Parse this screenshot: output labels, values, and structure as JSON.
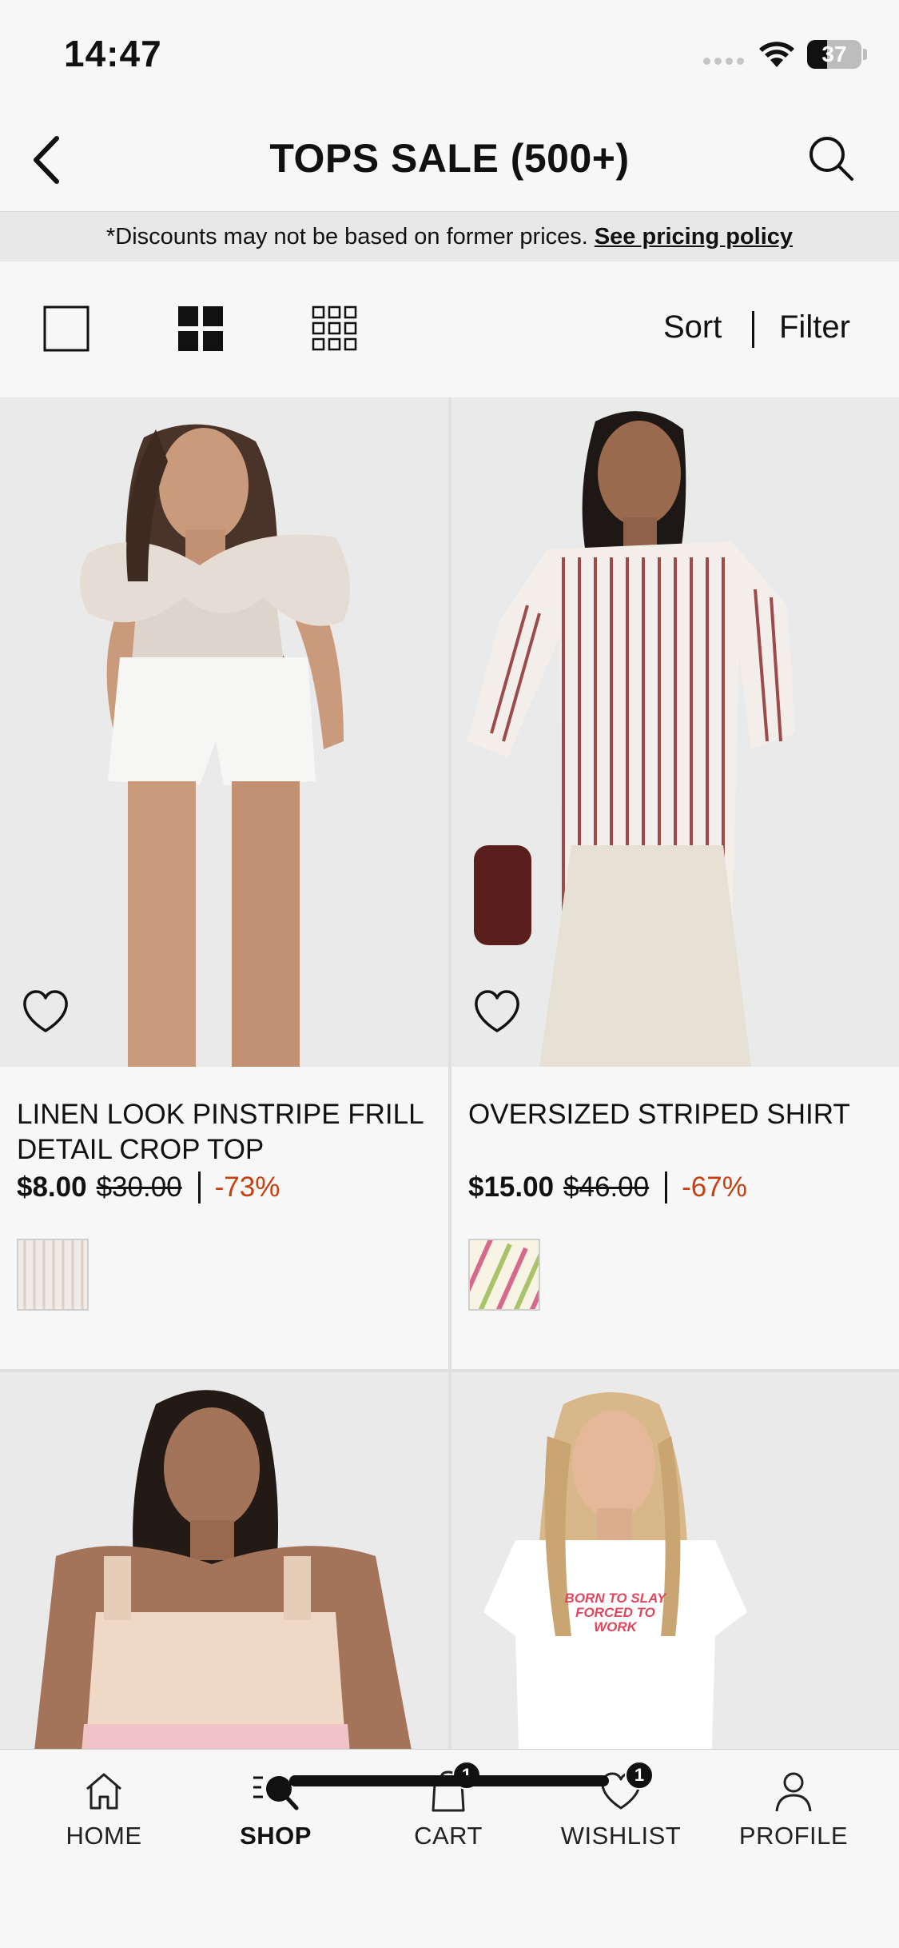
{
  "status_bar": {
    "time": "14:47",
    "battery": "37",
    "battery_level": 0.37
  },
  "header": {
    "title": "TOPS SALE (500+)"
  },
  "notice": {
    "text": "*Discounts may not be based on former prices.",
    "link_text": "See pricing policy"
  },
  "toolbar": {
    "sort_label": "Sort",
    "filter_label": "Filter"
  },
  "products": [
    {
      "name": "LINEN LOOK PINSTRIPE FRILL DETAIL CROP TOP",
      "price": "$8.00",
      "was_price": "$30.00",
      "discount": "-73%"
    },
    {
      "name": "OVERSIZED STRIPED SHIRT",
      "price": "$15.00",
      "was_price": "$46.00",
      "discount": "-67%"
    },
    {
      "name": "",
      "price": "",
      "was_price": "",
      "discount": ""
    },
    {
      "name": "",
      "price": "",
      "was_price": "",
      "discount": "",
      "tshirt_print": "BORN TO SLAY FORCED TO WORK"
    }
  ],
  "bottom_nav": {
    "items": [
      {
        "label": "HOME",
        "icon": "home-icon"
      },
      {
        "label": "SHOP",
        "icon": "shop-search-icon",
        "active": true
      },
      {
        "label": "CART",
        "icon": "bag-icon",
        "badge": "1"
      },
      {
        "label": "WISHLIST",
        "icon": "heart-icon",
        "badge": "1"
      },
      {
        "label": "PROFILE",
        "icon": "person-icon"
      }
    ]
  },
  "colors": {
    "discount": "#c6400f",
    "text": "#111111",
    "background": "#f7f7f7"
  }
}
